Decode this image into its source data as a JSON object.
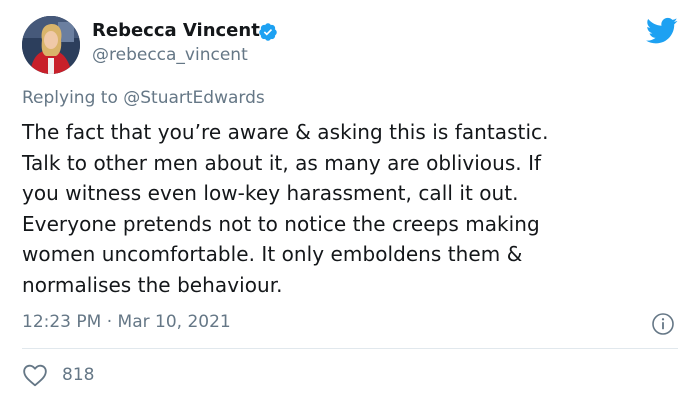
{
  "author": {
    "display_name": "Rebecca Vincent",
    "handle": "@rebecca_vincent"
  },
  "reply": {
    "prefix": "Replying to",
    "mention": "@StuartEdwards"
  },
  "tweet": {
    "lines": [
      "The fact that you’re aware & asking this is fantastic.",
      "Talk to other men about it, as many are oblivious. If",
      "you witness even low-key harassment, call it out.",
      "Everyone pretends not to notice the creeps making",
      "women uncomfortable. It only emboldens them &",
      "normalises the behaviour."
    ],
    "time": "12:23 PM",
    "separator": "·",
    "date": "Mar 10, 2021"
  },
  "engagement": {
    "likes": "818"
  },
  "icons": {
    "verified": "verified-badge-icon",
    "brand": "twitter-bird-icon",
    "info": "info-icon",
    "like": "heart-icon"
  },
  "colors": {
    "brand": "#1da1f2",
    "text": "#14171a",
    "muted": "#657786",
    "divider": "#e1e8ed"
  }
}
